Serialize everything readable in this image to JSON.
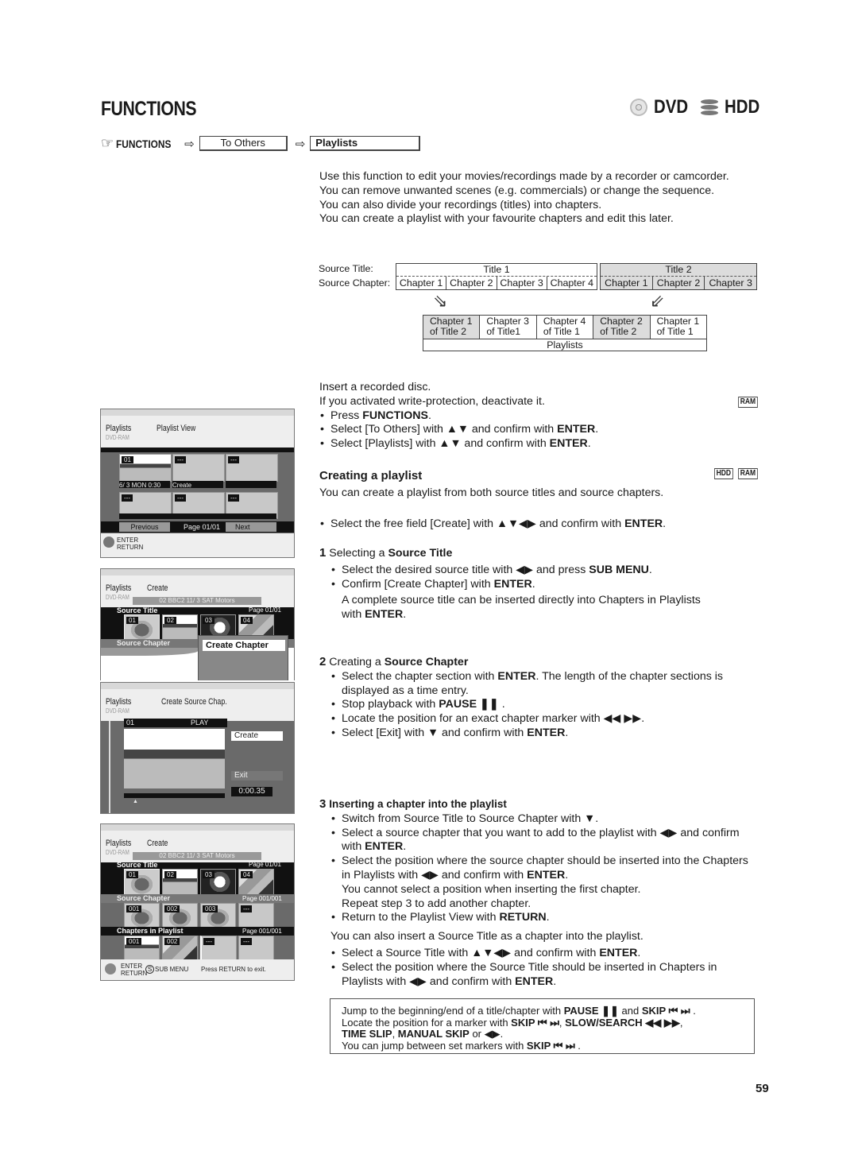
{
  "page": {
    "title": "FUNCTIONS",
    "disc_labels": [
      "DVD",
      "HDD"
    ],
    "page_number": "59"
  },
  "nav": {
    "root": "FUNCTIONS",
    "step1": "To Others",
    "step2": "Playlists"
  },
  "intro": [
    "Use this function to edit your movies/recordings made by a recorder or camcorder.",
    "You can remove unwanted scenes (e.g. commercials) or change the sequence.",
    "You can also divide your recordings (titles) into chapters.",
    "You can create a playlist with your favourite chapters and edit this later."
  ],
  "diagram": {
    "source_title_label": "Source Title:",
    "source_chapter_label": "Source Chapter:",
    "title1": {
      "name": "Title 1",
      "chapters": [
        "Chapter 1",
        "Chapter 2",
        "Chapter 3",
        "Chapter 4"
      ]
    },
    "title2": {
      "name": "Title 2",
      "chapters": [
        "Chapter 1",
        "Chapter 2",
        "Chapter 3"
      ]
    },
    "playlist_cells": [
      {
        "line1": "Chapter 1",
        "line2": "of Title 2"
      },
      {
        "line1": "Chapter 3",
        "line2": "of Title1"
      },
      {
        "line1": "Chapter 4",
        "line2": "of Title 1"
      },
      {
        "line1": "Chapter 2",
        "line2": "of Title 2"
      },
      {
        "line1": "Chapter 1",
        "line2": "of Title 1"
      }
    ],
    "playlist_label": "Playlists"
  },
  "prep": {
    "line1": "Insert a recorded disc.",
    "line2": "If you activated write-protection, deactivate it.",
    "tag": "RAM",
    "bullets": [
      {
        "pre": "Press ",
        "b": "FUNCTIONS",
        "post": "."
      },
      {
        "pre": "Select [To Others] with ▲▼ and confirm with ",
        "b": "ENTER",
        "post": "."
      },
      {
        "pre": "Select [Playlists] with ▲▼ and confirm with ",
        "b": "ENTER",
        "post": "."
      }
    ]
  },
  "section": {
    "heading": "Creating a playlist",
    "tags": [
      "HDD",
      "RAM"
    ],
    "desc": "You can create a playlist from both source titles and source chapters.",
    "bullet": {
      "pre": "Select the free field [Create] with ▲▼◀▶ and confirm with ",
      "b": "ENTER",
      "post": "."
    }
  },
  "step1": {
    "num": "1",
    "pre": "Selecting a ",
    "b": "Source Title",
    "bullets": [
      {
        "pre": "Select the desired source title with ◀▶ and press ",
        "b": "SUB MENU",
        "post": "."
      },
      {
        "pre": "Confirm [Create Chapter] with ",
        "b": "ENTER",
        "post": "."
      }
    ],
    "note_pre": "A complete source title can be inserted directly into Chapters in Playlists with ",
    "note_b": "ENTER",
    "note_post": "."
  },
  "step2": {
    "num": "2",
    "pre": "Creating a ",
    "b": "Source Chapter",
    "bullets": [
      {
        "pre": "Select the chapter section with ",
        "b": "ENTER",
        "post": ". The length of the chapter sections is displayed as a time entry."
      },
      {
        "pre": "Stop playback with ",
        "b": "PAUSE ❚❚",
        "post": " ."
      },
      {
        "pre": "Locate the position for an exact chapter marker with ◀◀ ▶▶.",
        "b": "",
        "post": ""
      },
      {
        "pre": "Select [Exit] with ▼ and confirm with ",
        "b": "ENTER",
        "post": "."
      }
    ]
  },
  "step3": {
    "num": "3",
    "b": "Inserting a chapter into the playlist",
    "bullets": [
      {
        "pre": "Switch from Source Title to Source Chapter with ▼.",
        "b": "",
        "post": ""
      },
      {
        "pre": "Select a source chapter that you want to add to the playlist with ◀▶ and confirm with ",
        "b": "ENTER",
        "post": "."
      },
      {
        "pre": "Select the position where the source chapter should be inserted into the Chapters in Playlists with ◀▶ and confirm with ",
        "b": "ENTER",
        "post": ".",
        "extra": [
          "You cannot select a position when inserting the first chapter.",
          "Repeat step 3 to add another chapter."
        ]
      },
      {
        "pre": "Return to the Playlist View with ",
        "b": "RETURN",
        "post": "."
      }
    ],
    "also": "You can also insert a Source Title as a chapter into the playlist.",
    "also_bullets": [
      {
        "pre": "Select a Source Title with ▲▼◀▶ and confirm with ",
        "b": "ENTER",
        "post": "."
      },
      {
        "pre": "Select the position where the Source Title should be inserted in Chapters in Playlists with ◀▶ and confirm with ",
        "b": "ENTER",
        "post": "."
      }
    ]
  },
  "note": {
    "l1_pre": "Jump to the beginning/end of a title/chapter with ",
    "l1_b1": "PAUSE ❚❚",
    "l1_mid": " and ",
    "l1_b2": "SKIP ⏮ ⏭",
    "l1_post": " .",
    "l2_pre": "Locate the position for a marker with ",
    "l2_b1": "SKIP ⏮ ⏭",
    "l2_mid": ", ",
    "l2_b2": "SLOW/SEARCH ◀◀ ▶▶",
    "l2_post": ",",
    "l3_b1": "TIME SLIP",
    "l3_mid": ", ",
    "l3_b2": "MANUAL SKIP",
    "l3_post": " or ◀▶.",
    "l4_pre": "You can jump between set markers with ",
    "l4_b": "SKIP ⏮ ⏭",
    "l4_post": " ."
  },
  "screens": {
    "s1": {
      "menu": "Playlists",
      "sub": "Playlist View",
      "disc": "DVD-RAM",
      "thumb1_num": "01",
      "thumb1_caption": "6/ 3 MON    0:30",
      "create_label": "Create",
      "empty_num": "---",
      "prev": "Previous",
      "page": "Page 01/01",
      "next": "Next",
      "enter": "ENTER",
      "return": "RETURN"
    },
    "s2": {
      "menu": "Playlists",
      "sub": "Create",
      "disc": "DVD-RAM",
      "info": "02  BBC2   11/ 3 SAT     Motors",
      "source_title": "Source Title",
      "page": "Page  01/01",
      "thumbs": [
        "01",
        "02",
        "03",
        "04"
      ],
      "source_chapter": "Source Chapter",
      "popup": "Create Chapter",
      "empty_num": "---"
    },
    "s3": {
      "menu": "Playlists",
      "sub": "Create Source Chap.",
      "disc": "DVD-RAM",
      "num": "01",
      "status": "PLAY",
      "create": "Create",
      "exit": "Exit",
      "time": "0:00.35"
    },
    "s4": {
      "menu": "Playlists",
      "sub": "Create",
      "disc": "DVD-RAM",
      "info": "02  BBC2   11/ 3 SAT     Motors",
      "source_title": "Source Title",
      "st_page": "Page  01/01",
      "st_thumbs": [
        "01",
        "02",
        "03",
        "04"
      ],
      "source_chapter": "Source Chapter",
      "sc_page": "Page  001/001",
      "sc_thumbs": [
        "001",
        "002",
        "003",
        "---"
      ],
      "chapters_in_playlist": "Chapters in Playlist",
      "cp_page": "Page  001/001",
      "cp_thumbs": [
        "001",
        "002",
        "---",
        "---"
      ],
      "enter": "ENTER",
      "return": "RETURN",
      "submenu": "SUB MENU",
      "exit_hint": "Press RETURN to exit."
    }
  }
}
